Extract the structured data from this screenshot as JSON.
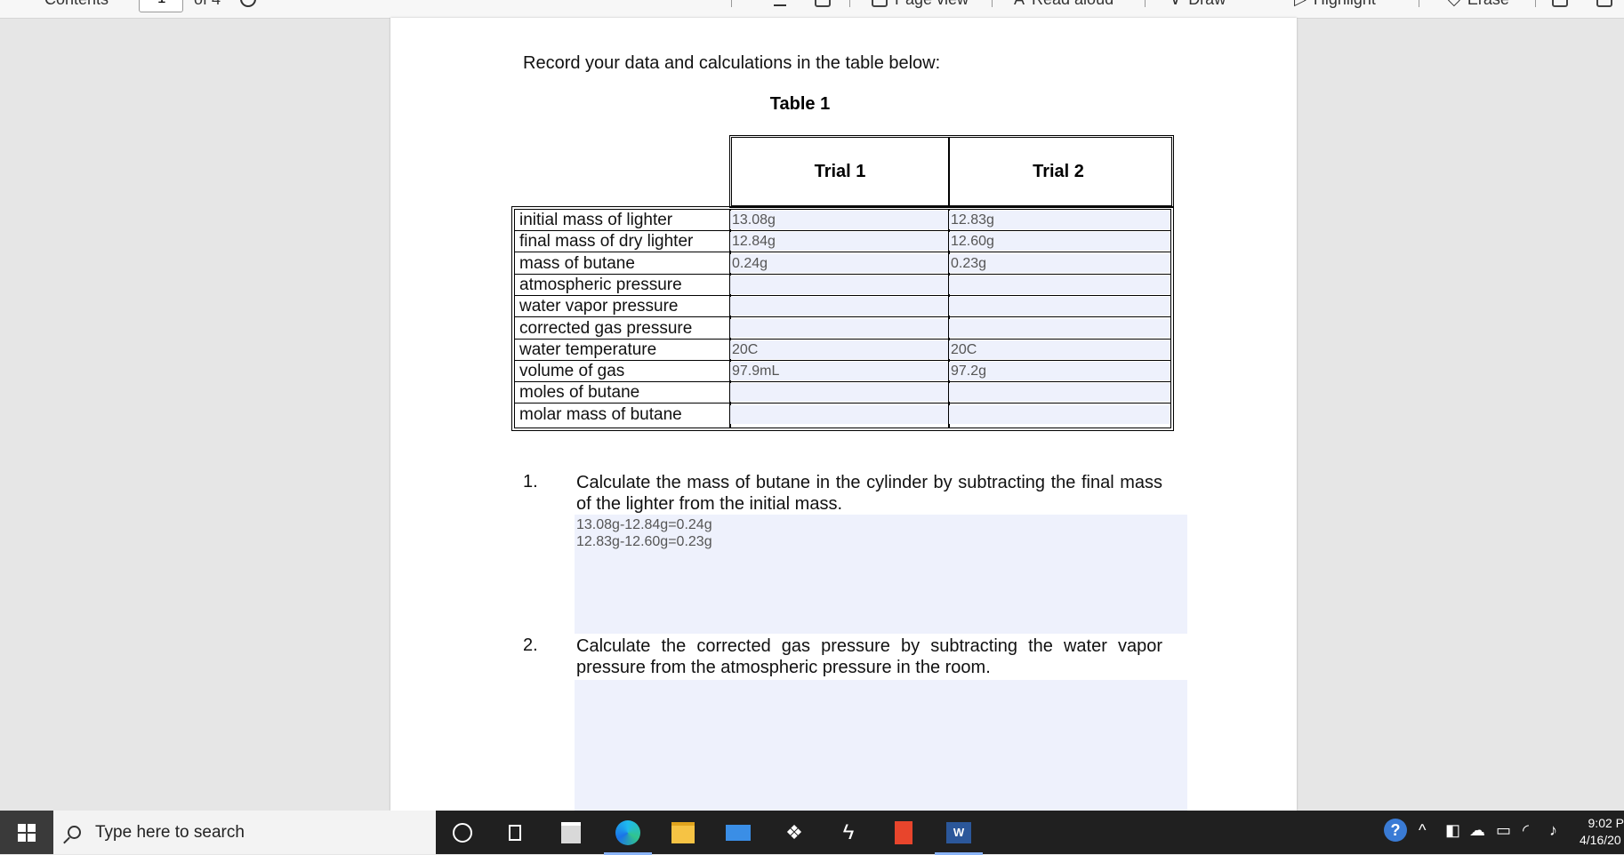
{
  "toolbar": {
    "contents_label": "Contents",
    "page_current": "1",
    "page_total": "of 4",
    "page_view_label": "Page view",
    "read_aloud_label": "Read aloud",
    "draw_label": "Draw",
    "highlight_label": "Highlight",
    "erase_label": "Erase"
  },
  "document": {
    "intro": "Record your data and calculations in the table below:",
    "table_title": "Table 1",
    "columns": [
      "Trial 1",
      "Trial 2"
    ],
    "rows": [
      {
        "label": "initial mass of lighter",
        "trial1": "13.08g",
        "trial2": "12.83g"
      },
      {
        "label": "final mass of dry lighter",
        "trial1": "12.84g",
        "trial2": "12.60g"
      },
      {
        "label": "mass of butane",
        "trial1": "0.24g",
        "trial2": "0.23g"
      },
      {
        "label": "atmospheric pressure",
        "trial1": "",
        "trial2": ""
      },
      {
        "label": "water vapor pressure",
        "trial1": "",
        "trial2": ""
      },
      {
        "label": "corrected gas pressure",
        "trial1": "",
        "trial2": ""
      },
      {
        "label": "water temperature",
        "trial1": "20C",
        "trial2": "20C"
      },
      {
        "label": "volume of gas",
        "trial1": "97.9mL",
        "trial2": "97.2g"
      },
      {
        "label": "moles of butane",
        "trial1": "",
        "trial2": ""
      },
      {
        "label": "molar mass of butane",
        "trial1": "",
        "trial2": ""
      }
    ],
    "questions": [
      {
        "number": "1.",
        "text": "Calculate the mass of butane in the cylinder by subtracting the final mass of the lighter from the initial mass.",
        "answer": "13.08g-12.84g=0.24g\n12.83g-12.60g=0.23g"
      },
      {
        "number": "2.",
        "text": "Calculate the corrected gas pressure by subtracting the water vapor pressure from the atmospheric pressure in the room.",
        "answer": ""
      }
    ]
  },
  "taskbar": {
    "search_placeholder": "Type here to search",
    "time": "9:02 P",
    "date": "4/16/20",
    "apps": [
      "cortana",
      "task-view",
      "store",
      "edge",
      "file-explorer",
      "mail",
      "dropbox",
      "app-arrow",
      "office",
      "word"
    ]
  },
  "colors": {
    "form_field_bg": "#eef1fc",
    "taskbar_bg": "#202020",
    "page_bg": "#ffffff",
    "desktop_bg": "#e6e6e6"
  }
}
